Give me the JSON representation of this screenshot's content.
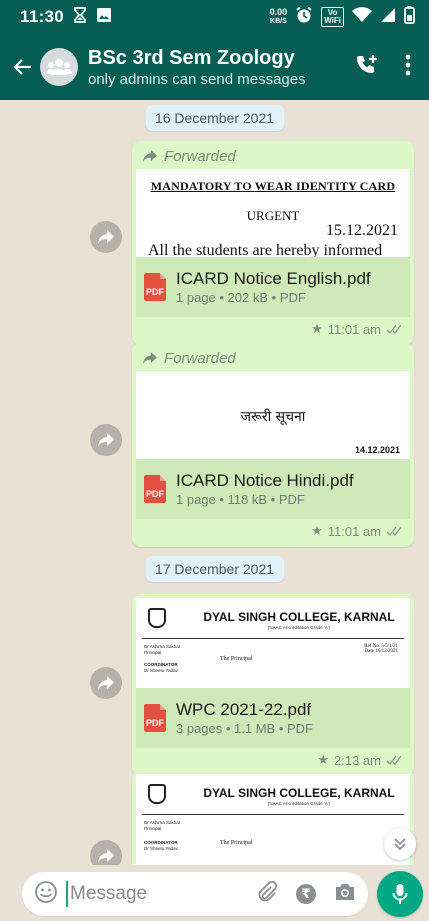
{
  "status_bar": {
    "time": "11:30",
    "speed_value": "0.00",
    "speed_unit": "KB/S",
    "wifi_label_top": "Vo",
    "wifi_label_bottom": "WiFi"
  },
  "header": {
    "title": "BSc 3rd Sem Zoology",
    "subtitle": "only admins can send messages"
  },
  "messages": [
    {
      "date": "16 December 2021",
      "forwarded_label": "Forwarded",
      "preview": {
        "heading": "MANDATORY TO WEAR IDENTITY CARD",
        "urgent": "URGENT",
        "date": "15.12.2021",
        "body": "All the students are hereby informed"
      },
      "file_name": "ICARD Notice English.pdf",
      "file_meta": "1 page • 202 kB • PDF",
      "time": "11:01 am",
      "starred": true
    },
    {
      "forwarded_label": "Forwarded",
      "preview": {
        "heading": "जरूरी सूचना",
        "date": "14.12.2021"
      },
      "file_name": "ICARD Notice Hindi.pdf",
      "file_meta": "1 page • 118 kB • PDF",
      "time": "11:01 am",
      "starred": true
    },
    {
      "date": "17 December 2021",
      "preview": {
        "college": "DYAL SINGH COLLEGE, KARNAL",
        "college_sub": "(NAAC Accreditation Grade 'A')",
        "left_1": "Dr Ashima Sakhar",
        "left_2": "Principal",
        "left_3": "COORDINATOR",
        "left_4": "Dr Sheetu Yadav",
        "addressee": "The Principal",
        "ref": "Ref No. 5/5/1/21",
        "ref_date": "Date 16/12/2021"
      },
      "file_name": "WPC 2021-22.pdf",
      "file_meta": "3 pages • 1.1 MB • PDF",
      "time": "2:13 am",
      "starred": true
    },
    {
      "preview": {
        "college": "DYAL SINGH COLLEGE, KARNAL",
        "college_sub": "(NAAC Accreditation Grade 'A')",
        "left_1": "Dr Ashima Sakhar",
        "left_2": "Principal",
        "left_3": "COORDINATOR",
        "left_4": "Dr Sheetu Yadav",
        "addressee": "The Principal"
      }
    }
  ],
  "input_bar": {
    "placeholder": "Message",
    "currency_symbol": "₹"
  },
  "colors": {
    "header": "#075e54",
    "bubble": "#dcf8c6",
    "accent": "#00a884",
    "chat_bg": "#e9e1d6"
  }
}
